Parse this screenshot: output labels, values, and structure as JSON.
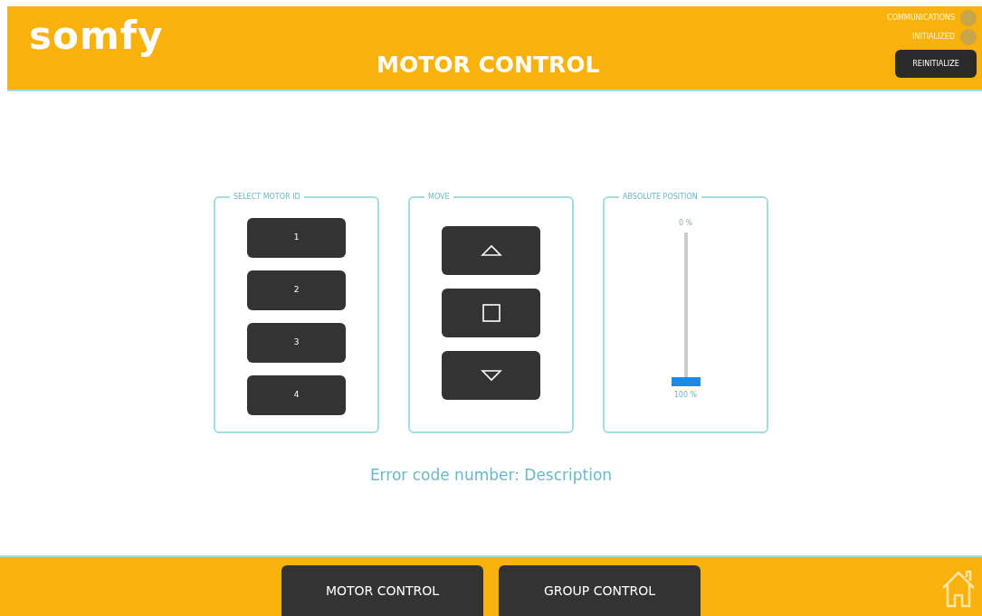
{
  "header": {
    "logo": "somfy",
    "title": "MOTOR CONTROL",
    "indicators": [
      {
        "label": "COMMUNICATIONS",
        "on": false
      },
      {
        "label": "INITIALIZED",
        "on": false
      }
    ],
    "reinitialize_button": "REINITIALIZE"
  },
  "panels": [
    {
      "kind": "motors",
      "title": "SELECT MOTOR ID",
      "buttons": [
        "1",
        "2",
        "3",
        "4"
      ]
    },
    {
      "kind": "move",
      "title": "MOVE",
      "buttons": [
        {
          "kind": "up"
        },
        {
          "kind": "stop"
        },
        {
          "kind": "down"
        }
      ]
    },
    {
      "kind": "position",
      "title": "ABSOLUTE POSITION",
      "top_label": "0 %",
      "bottom_label": "100 %"
    }
  ],
  "error_message": "Error code number: Description",
  "footer": {
    "tabs": [
      {
        "label": "MOTOR CONTROL"
      },
      {
        "label": "GROUP CONTROL"
      }
    ]
  }
}
